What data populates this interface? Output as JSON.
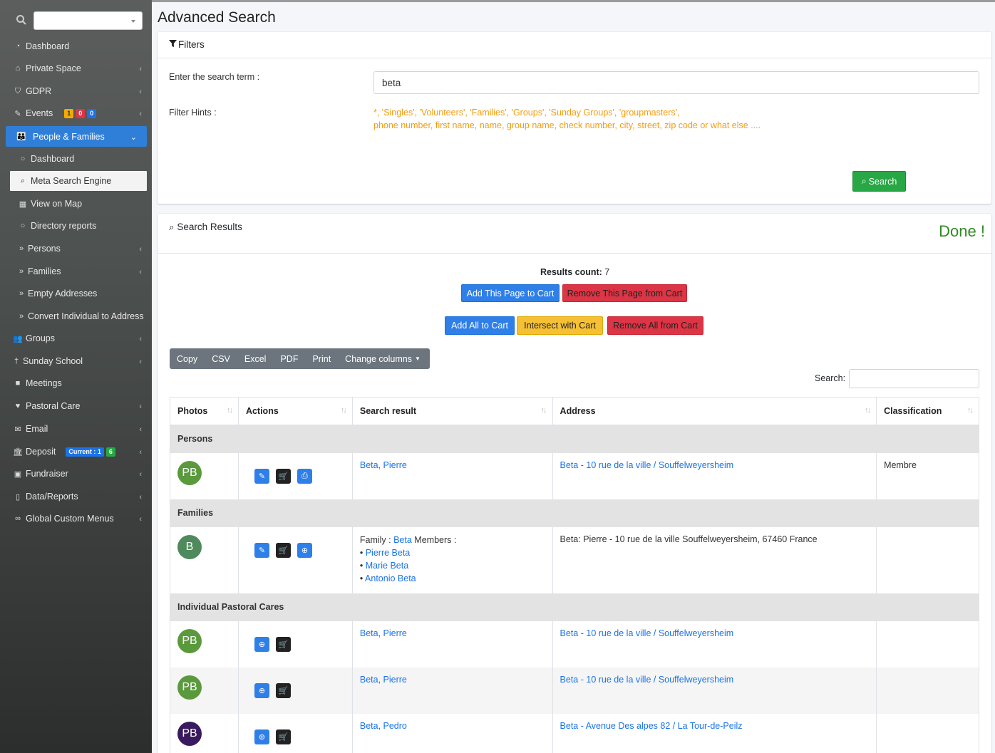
{
  "sidebar": {
    "search_placeholder": "",
    "items": [
      {
        "label": "Dashboard",
        "icon": "dashboard-icon"
      },
      {
        "label": "Private Space",
        "icon": "home-icon"
      },
      {
        "label": "GDPR",
        "icon": "shield-icon"
      },
      {
        "label": "Events",
        "icon": "ticket-icon",
        "badges": [
          "1",
          "0",
          "0"
        ]
      },
      {
        "label": "People & Families",
        "icon": "people-icon"
      },
      {
        "label": "Dashboard",
        "icon": "circle-icon"
      },
      {
        "label": "Meta Search Engine",
        "icon": "search-icon"
      },
      {
        "label": "View on Map",
        "icon": "map-icon"
      },
      {
        "label": "Directory reports",
        "icon": "circle-icon"
      },
      {
        "label": "Persons",
        "icon": "double-chevron-icon"
      },
      {
        "label": "Families",
        "icon": "double-chevron-icon"
      },
      {
        "label": "Empty Addresses",
        "icon": "double-chevron-icon"
      },
      {
        "label": "Convert Individual to Address",
        "icon": "double-chevron-icon"
      },
      {
        "label": "Groups",
        "icon": "users-icon"
      },
      {
        "label": "Sunday School",
        "icon": "child-icon"
      },
      {
        "label": "Meetings",
        "icon": "video-icon"
      },
      {
        "label": "Pastoral Care",
        "icon": "heart-icon"
      },
      {
        "label": "Email",
        "icon": "envelope-icon"
      },
      {
        "label": "Deposit",
        "icon": "bank-icon",
        "badges": [
          "Current : 1",
          "6"
        ]
      },
      {
        "label": "Fundraiser",
        "icon": "money-icon"
      },
      {
        "label": "Data/Reports",
        "icon": "file-icon"
      },
      {
        "label": "Global Custom Menus",
        "icon": "link-icon"
      }
    ]
  },
  "page": {
    "title": "Advanced Search"
  },
  "filters": {
    "header": "Filters",
    "search_label": "Enter the search term :",
    "search_value": "beta",
    "hints_label": "Filter Hints :",
    "hints_line1": "*, 'Singles', 'Volunteers', 'Families', 'Groups', 'Sunday Groups', 'groupmasters',",
    "hints_line2": "phone number, first name, name, group name, check number, city, street, zip code or what else ....",
    "search_button": "Search"
  },
  "results": {
    "header": "Search Results",
    "status": "Done !",
    "count_label": "Results count:",
    "count_value": "7",
    "add_page": "Add This Page to Cart",
    "remove_page": "Remove This Page from Cart",
    "add_all": "Add All to Cart",
    "intersect": "Intersect with Cart",
    "remove_all": "Remove All from Cart",
    "export_buttons": [
      "Copy",
      "CSV",
      "Excel",
      "PDF",
      "Print",
      "Change columns"
    ],
    "search_label": "Search:",
    "columns": [
      "Photos",
      "Actions",
      "Search result",
      "Address",
      "Classification"
    ],
    "groups": {
      "persons": "Persons",
      "families": "Families",
      "pastoral": "Individual Pastoral Cares"
    },
    "rows": {
      "person1": {
        "initials": "PB",
        "name": "Beta, Pierre",
        "address": "Beta - 10 rue de la ville / Souffelweyersheim",
        "classification": "Membre"
      },
      "family1": {
        "initials": "B",
        "prefix": "Family :",
        "family_name": "Beta",
        "members_label": "Members :",
        "members": [
          "Pierre Beta",
          "Marie Beta",
          "Antonio Beta"
        ],
        "address": "Beta: Pierre - 10 rue de la ville Souffelweyersheim, 67460 France"
      },
      "pastoral1": {
        "initials": "PB",
        "name": "Beta, Pierre",
        "address": "Beta - 10 rue de la ville / Souffelweyersheim"
      },
      "pastoral2": {
        "initials": "PB",
        "name": "Beta, Pierre",
        "address": "Beta - 10 rue de la ville / Souffelweyersheim"
      },
      "pastoral3": {
        "initials": "PB",
        "name": "Beta, Pedro",
        "address": "Beta - Avenue Des alpes 82 / La Tour-de-Peilz"
      }
    }
  },
  "colors": {
    "sidebar_active": "#2f7fd8",
    "primary": "#2f7fe8",
    "danger": "#dc3545",
    "warning": "#f5c034",
    "success": "#28a745",
    "hint": "#f39c12",
    "done": "#2e8b22",
    "avatar_green": "#5a9a3c",
    "avatar_teal": "#4f8a5c",
    "avatar_purple": "#3a1a5e"
  }
}
